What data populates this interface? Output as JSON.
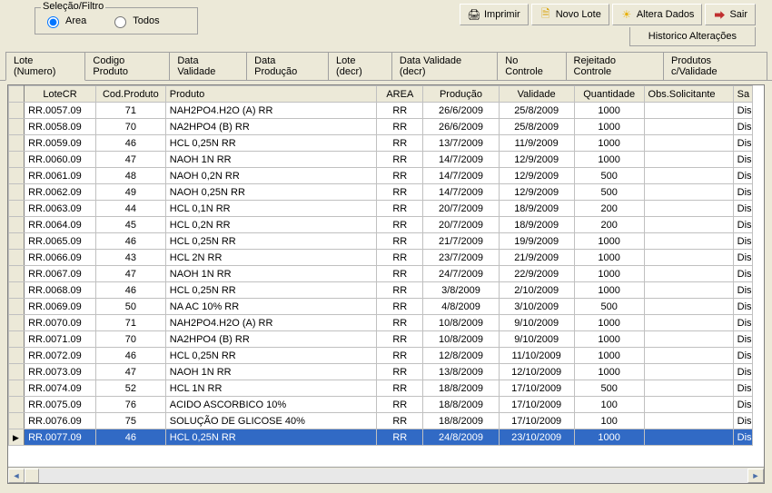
{
  "filter": {
    "legend": "Seleção/Filtro",
    "opt_area": "Area",
    "opt_todos": "Todos"
  },
  "toolbar": {
    "print": "Imprimir",
    "novo": "Novo Lote",
    "altera": "Altera Dados",
    "sair": "Sair",
    "historico": "Historico Alterações"
  },
  "tabs": [
    {
      "label": "Lote (Numero)"
    },
    {
      "label": "Codigo Produto"
    },
    {
      "label": "Data Validade"
    },
    {
      "label": "Data Produção"
    },
    {
      "label": "Lote  (decr)"
    },
    {
      "label": "Data Validade (decr)"
    },
    {
      "label": "No Controle"
    },
    {
      "label": "Rejeitado Controle"
    },
    {
      "label": "Produtos c/Validade"
    }
  ],
  "columns": {
    "lote": "LoteCR",
    "cod": "Cod.Produto",
    "prod": "Produto",
    "area": "AREA",
    "dprod": "Produção",
    "dval": "Validade",
    "qtd": "Quantidade",
    "obs": "Obs.Solicitante",
    "sa": "Sa"
  },
  "rows": [
    {
      "lote": "RR.0057.09",
      "cod": "71",
      "prod": "NAH2PO4.H2O (A) RR",
      "area": "RR",
      "dprod": "26/6/2009",
      "dval": "25/8/2009",
      "qtd": "1000",
      "obs": "",
      "sa": "Dis"
    },
    {
      "lote": "RR.0058.09",
      "cod": "70",
      "prod": "NA2HPO4 (B) RR",
      "area": "RR",
      "dprod": "26/6/2009",
      "dval": "25/8/2009",
      "qtd": "1000",
      "obs": "",
      "sa": "Dis"
    },
    {
      "lote": "RR.0059.09",
      "cod": "46",
      "prod": "HCL 0,25N RR",
      "area": "RR",
      "dprod": "13/7/2009",
      "dval": "11/9/2009",
      "qtd": "1000",
      "obs": "",
      "sa": "Dis"
    },
    {
      "lote": "RR.0060.09",
      "cod": "47",
      "prod": "NAOH 1N RR",
      "area": "RR",
      "dprod": "14/7/2009",
      "dval": "12/9/2009",
      "qtd": "1000",
      "obs": "",
      "sa": "Dis"
    },
    {
      "lote": "RR.0061.09",
      "cod": "48",
      "prod": "NAOH 0,2N RR",
      "area": "RR",
      "dprod": "14/7/2009",
      "dval": "12/9/2009",
      "qtd": "500",
      "obs": "",
      "sa": "Dis"
    },
    {
      "lote": "RR.0062.09",
      "cod": "49",
      "prod": "NAOH 0,25N RR",
      "area": "RR",
      "dprod": "14/7/2009",
      "dval": "12/9/2009",
      "qtd": "500",
      "obs": "",
      "sa": "Dis"
    },
    {
      "lote": "RR.0063.09",
      "cod": "44",
      "prod": "HCL 0,1N  RR",
      "area": "RR",
      "dprod": "20/7/2009",
      "dval": "18/9/2009",
      "qtd": "200",
      "obs": "",
      "sa": "Dis"
    },
    {
      "lote": "RR.0064.09",
      "cod": "45",
      "prod": "HCL 0,2N  RR",
      "area": "RR",
      "dprod": "20/7/2009",
      "dval": "18/9/2009",
      "qtd": "200",
      "obs": "",
      "sa": "Dis"
    },
    {
      "lote": "RR.0065.09",
      "cod": "46",
      "prod": "HCL 0,25N RR",
      "area": "RR",
      "dprod": "21/7/2009",
      "dval": "19/9/2009",
      "qtd": "1000",
      "obs": "",
      "sa": "Dis"
    },
    {
      "lote": "RR.0066.09",
      "cod": "43",
      "prod": "HCL 2N RR",
      "area": "RR",
      "dprod": "23/7/2009",
      "dval": "21/9/2009",
      "qtd": "1000",
      "obs": "",
      "sa": "Dis"
    },
    {
      "lote": "RR.0067.09",
      "cod": "47",
      "prod": "NAOH 1N RR",
      "area": "RR",
      "dprod": "24/7/2009",
      "dval": "22/9/2009",
      "qtd": "1000",
      "obs": "",
      "sa": "Dis"
    },
    {
      "lote": "RR.0068.09",
      "cod": "46",
      "prod": "HCL 0,25N RR",
      "area": "RR",
      "dprod": "3/8/2009",
      "dval": "2/10/2009",
      "qtd": "1000",
      "obs": "",
      "sa": "Dis"
    },
    {
      "lote": "RR.0069.09",
      "cod": "50",
      "prod": "NA AC 10%  RR",
      "area": "RR",
      "dprod": "4/8/2009",
      "dval": "3/10/2009",
      "qtd": "500",
      "obs": "",
      "sa": "Dis"
    },
    {
      "lote": "RR.0070.09",
      "cod": "71",
      "prod": "NAH2PO4.H2O (A) RR",
      "area": "RR",
      "dprod": "10/8/2009",
      "dval": "9/10/2009",
      "qtd": "1000",
      "obs": "",
      "sa": "Dis"
    },
    {
      "lote": "RR.0071.09",
      "cod": "70",
      "prod": "NA2HPO4 (B) RR",
      "area": "RR",
      "dprod": "10/8/2009",
      "dval": "9/10/2009",
      "qtd": "1000",
      "obs": "",
      "sa": "Dis"
    },
    {
      "lote": "RR.0072.09",
      "cod": "46",
      "prod": "HCL 0,25N RR",
      "area": "RR",
      "dprod": "12/8/2009",
      "dval": "11/10/2009",
      "qtd": "1000",
      "obs": "",
      "sa": "Dis"
    },
    {
      "lote": "RR.0073.09",
      "cod": "47",
      "prod": "NAOH 1N RR",
      "area": "RR",
      "dprod": "13/8/2009",
      "dval": "12/10/2009",
      "qtd": "1000",
      "obs": "",
      "sa": "Dis"
    },
    {
      "lote": "RR.0074.09",
      "cod": "52",
      "prod": "HCL 1N RR",
      "area": "RR",
      "dprod": "18/8/2009",
      "dval": "17/10/2009",
      "qtd": "500",
      "obs": "",
      "sa": "Dis"
    },
    {
      "lote": "RR.0075.09",
      "cod": "76",
      "prod": "ACIDO ASCORBICO 10%",
      "area": "RR",
      "dprod": "18/8/2009",
      "dval": "17/10/2009",
      "qtd": "100",
      "obs": "",
      "sa": "Dis"
    },
    {
      "lote": "RR.0076.09",
      "cod": "75",
      "prod": "SOLUÇÃO DE GLICOSE 40%",
      "area": "RR",
      "dprod": "18/8/2009",
      "dval": "17/10/2009",
      "qtd": "100",
      "obs": "",
      "sa": "Dis"
    },
    {
      "lote": "RR.0077.09",
      "cod": "46",
      "prod": "HCL 0,25N RR",
      "area": "RR",
      "dprod": "24/8/2009",
      "dval": "23/10/2009",
      "qtd": "1000",
      "obs": "",
      "sa": "Dis",
      "selected": true
    }
  ]
}
